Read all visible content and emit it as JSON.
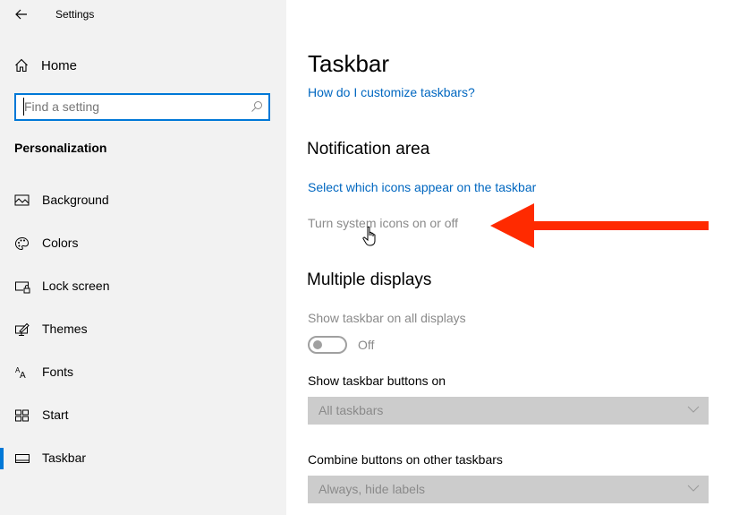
{
  "window": {
    "title": "Settings"
  },
  "sidebar": {
    "back_icon": "arrow-left-icon",
    "home": {
      "label": "Home",
      "icon": "home-icon"
    },
    "search": {
      "placeholder": "Find a setting",
      "value": "",
      "icon": "search-icon"
    },
    "section_title": "Personalization",
    "items": [
      {
        "label": "Background",
        "icon": "image-icon",
        "active": false
      },
      {
        "label": "Colors",
        "icon": "palette-icon",
        "active": false
      },
      {
        "label": "Lock screen",
        "icon": "lock-screen-icon",
        "active": false
      },
      {
        "label": "Themes",
        "icon": "themes-icon",
        "active": false
      },
      {
        "label": "Fonts",
        "icon": "fonts-icon",
        "active": false
      },
      {
        "label": "Start",
        "icon": "start-icon",
        "active": false
      },
      {
        "label": "Taskbar",
        "icon": "taskbar-icon",
        "active": true
      }
    ]
  },
  "main": {
    "title": "Taskbar",
    "help_link": "How do I customize taskbars?",
    "notification_area": {
      "heading": "Notification area",
      "select_icons_link": "Select which icons appear on the taskbar",
      "system_icons_link": "Turn system icons on or off"
    },
    "multiple_displays": {
      "heading": "Multiple displays",
      "show_all_label": "Show taskbar on all displays",
      "show_all_state": "Off",
      "show_all_enabled": false,
      "buttons_on_label": "Show taskbar buttons on",
      "buttons_on_value": "All taskbars",
      "combine_label": "Combine buttons on other taskbars",
      "combine_value": "Always, hide labels"
    }
  },
  "annotations": {
    "arrow_color": "#ff2a00",
    "pointer": "hand-cursor-icon"
  },
  "colors": {
    "accent": "#0078d7",
    "link": "#0067c0",
    "sidebar_bg": "#f2f2f2",
    "disabled": "#8a8a8a",
    "dropdown_bg": "#cccccc"
  }
}
